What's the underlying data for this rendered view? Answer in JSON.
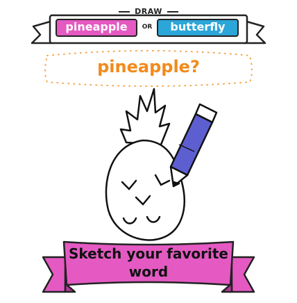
{
  "header": {
    "draw_label": "DRAW",
    "or_label": "OR",
    "option_a": "pineapple",
    "option_b": "butterfly"
  },
  "prompt": {
    "question": "pineapple?"
  },
  "footer": {
    "banner_text": "Sketch your favorite word"
  },
  "colors": {
    "pink": "#e45ac2",
    "blue": "#2ba6d9",
    "orange": "#f28a1c",
    "pencil": "#5d5fd0"
  }
}
